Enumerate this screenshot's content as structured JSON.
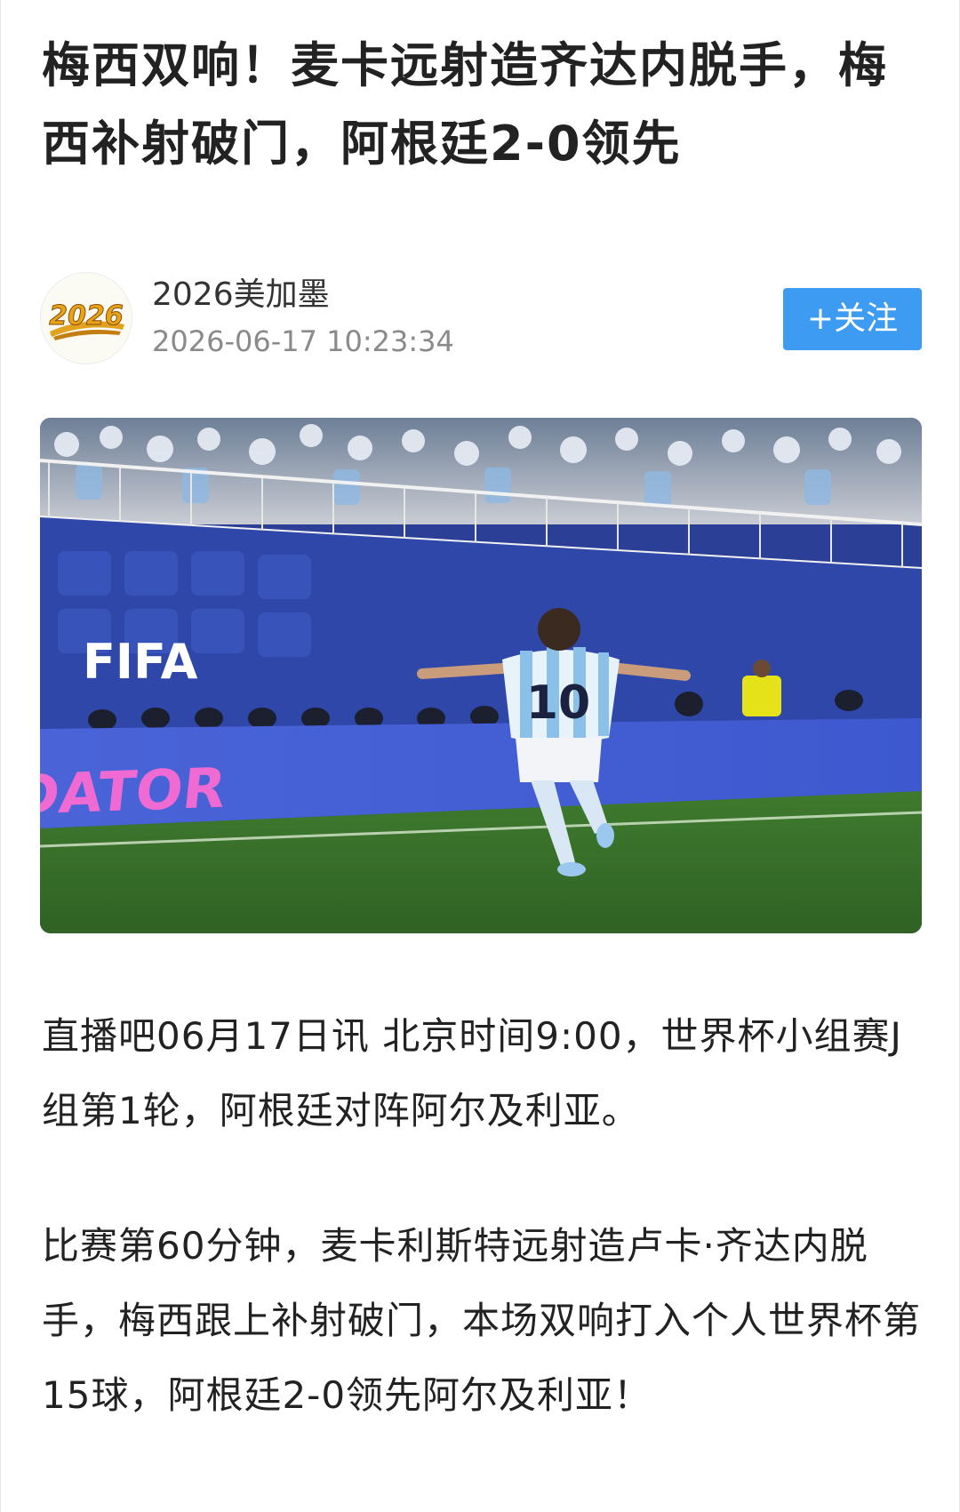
{
  "article": {
    "title": "梅西双响！麦卡远射造齐达内脱手，梅西补射破门，阿根廷2-0领先",
    "author": {
      "name": "2026美加墨",
      "avatar_text": "2026",
      "timestamp": "2026-06-17 10:23:34",
      "follow_label": "+关注"
    },
    "image": {
      "board_text": "FIFA",
      "ad_text": "DATOR",
      "jersey_number": "10",
      "icon": "photo-image"
    },
    "paragraphs": [
      "直播吧06月17日讯 北京时间9:00，世界杯小组赛J组第1轮，阿根廷对阵阿尔及利亚。",
      "比赛第60分钟，麦卡利斯特远射造卢卡·齐达内脱手，梅西跟上补射破门，本场双响打入个人世界杯第15球，阿根廷2-0领先阿尔及利亚！"
    ]
  },
  "colors": {
    "follow_button": "#3d9bf2",
    "title": "#222222",
    "meta": "#8a8a8a"
  }
}
